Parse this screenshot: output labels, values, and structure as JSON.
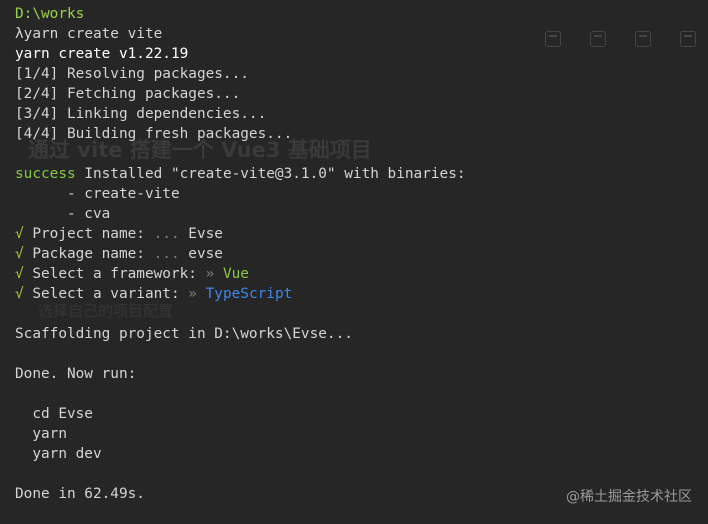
{
  "terminal": {
    "path_line": "D:\\works",
    "command_prompt": "λ",
    "command": "yarn create vite",
    "version_line": "yarn create v1.22.19",
    "steps": [
      "[1/4] Resolving packages...",
      "[2/4] Fetching packages...",
      "[3/4] Linking dependencies...",
      "[4/4] Building fresh packages..."
    ],
    "success_word": "success",
    "success_text": " Installed \"create-vite@3.1.0\" with binaries:",
    "binaries": [
      "      - create-vite",
      "      - cva"
    ],
    "prompts": [
      {
        "check": "√",
        "label": " Project name: ",
        "sep": "...",
        "value": " Evse"
      },
      {
        "check": "√",
        "label": " Package name: ",
        "sep": "...",
        "value": " evse"
      },
      {
        "check": "√",
        "label": " Select a framework: ",
        "sep": "»",
        "value": " Vue"
      },
      {
        "check": "√",
        "label": " Select a variant: ",
        "sep": "»",
        "value": " TypeScript"
      }
    ],
    "scaffolding": "Scaffolding project in D:\\works\\Evse...",
    "done_now_run": "Done. Now run:",
    "run_commands": [
      "  cd Evse",
      "  yarn",
      "  yarn dev"
    ],
    "done_time": "Done in 62.49s."
  },
  "watermark": "@稀土掘金技术社区",
  "colors": {
    "background": "#262626",
    "path": "#9ad34a",
    "success": "#84c942",
    "check": "#b6c438",
    "vue": "#8ec63f",
    "typescript": "#3f86e6"
  }
}
